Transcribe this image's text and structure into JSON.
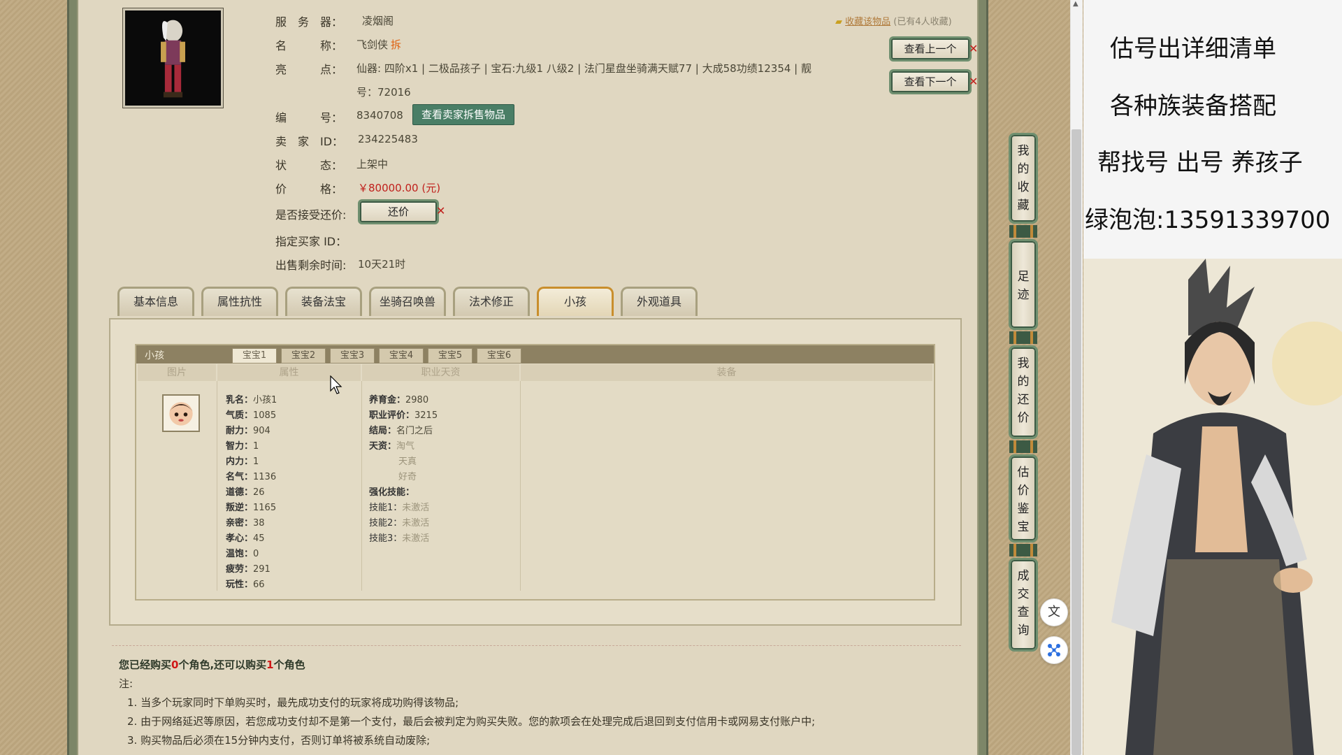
{
  "item": {
    "server_label": "服　务　器：",
    "server_value": "凌烟阁",
    "name_label": "名　　　称：",
    "name_value": "飞剑侠",
    "name_tag": "拆",
    "highlight_label": "亮　　　点：",
    "highlight_line1": "仙器: 四阶x1 | 二极品孩子 | 宝石:九级1 八级2 | 法门星盘坐骑满天赋77 | 大成58功绩12354 | 靓",
    "highlight_line2": "号：72016",
    "id_label": "编　　　号：",
    "id_value": "8340708",
    "view_seller_btn": "查看卖家拆售物品",
    "seller_label": "卖　家　ID：",
    "seller_value": "234225483",
    "status_label": "状　　　态：",
    "status_value": "上架中",
    "price_label": "价　　　格：",
    "price_value": "￥80000.00 (元)",
    "counter_label": "是否接受还价:",
    "counter_btn": "还价",
    "buyer_label": "指定买家 ID：",
    "remain_label": "出售剩余时间:",
    "remain_value": "10天21时"
  },
  "fav": {
    "link": "收藏该物品",
    "count": "(已有4人收藏)"
  },
  "nav_buttons": {
    "prev": "查看上一个",
    "next": "查看下一个"
  },
  "tabs": [
    "基本信息",
    "属性抗性",
    "装备法宝",
    "坐骑召唤兽",
    "法术修正",
    "小孩",
    "外观道具"
  ],
  "active_tab": "小孩",
  "child_panel": {
    "title": "小孩",
    "baby_tabs": [
      "宝宝1",
      "宝宝2",
      "宝宝3",
      "宝宝4",
      "宝宝5",
      "宝宝6"
    ],
    "columns": [
      "图片",
      "属性",
      "职业天资",
      "装备"
    ],
    "attrs": [
      {
        "k": "乳名：",
        "v": "小孩1"
      },
      {
        "k": "气质：",
        "v": "1085"
      },
      {
        "k": "耐力：",
        "v": "904"
      },
      {
        "k": "智力：",
        "v": "1"
      },
      {
        "k": "内力：",
        "v": "1"
      },
      {
        "k": "名气：",
        "v": "1136"
      },
      {
        "k": "道德：",
        "v": "26"
      },
      {
        "k": "叛逆：",
        "v": "1165"
      },
      {
        "k": "亲密：",
        "v": "38"
      },
      {
        "k": "孝心：",
        "v": "45"
      },
      {
        "k": "温饱：",
        "v": "0"
      },
      {
        "k": "疲劳：",
        "v": "291"
      },
      {
        "k": "玩性：",
        "v": "66"
      }
    ],
    "career": [
      {
        "k": "养育金：",
        "v": "2980"
      },
      {
        "k": "职业评价：",
        "v": "3215"
      },
      {
        "k": "结局：",
        "v": "名门之后"
      },
      {
        "k": "天资：",
        "v": "淘气"
      },
      {
        "k": "",
        "v": "天真"
      },
      {
        "k": "",
        "v": "好奇"
      },
      {
        "k": "强化技能：",
        "v": ""
      },
      {
        "k": "技能1：",
        "v": "未激活"
      },
      {
        "k": "技能2：",
        "v": "未激活"
      },
      {
        "k": "技能3：",
        "v": "未激活"
      }
    ]
  },
  "purchase": {
    "pre": "您已经购买",
    "bought": "0",
    "mid": "个角色,还可以购买",
    "can": "1",
    "post": "个角色",
    "note_label": "注:",
    "notes": [
      "1. 当多个玩家同时下单购买时，最先成功支付的玩家将成功购得该物品;",
      "2. 由于网络延迟等原因，若您成功支付却不是第一个支付，最后会被判定为购买失败。您的款项会在处理完成后退回到支付信用卡或网易支付账户中;",
      "3. 购买物品后必须在15分钟内支付，否则订单将被系统自动废除;"
    ]
  },
  "sidebar": [
    "我的收藏",
    "足迹",
    "我的还价",
    "估价鉴宝",
    "成交查询"
  ],
  "ad": {
    "lines": [
      "估号出详细清单",
      "各种族装备搭配",
      "帮找号 出号 养孩子",
      "绿泡泡:13591339700"
    ]
  },
  "floating": {
    "translate_icon": "translate-icon",
    "ai_icon": "network-icon"
  }
}
